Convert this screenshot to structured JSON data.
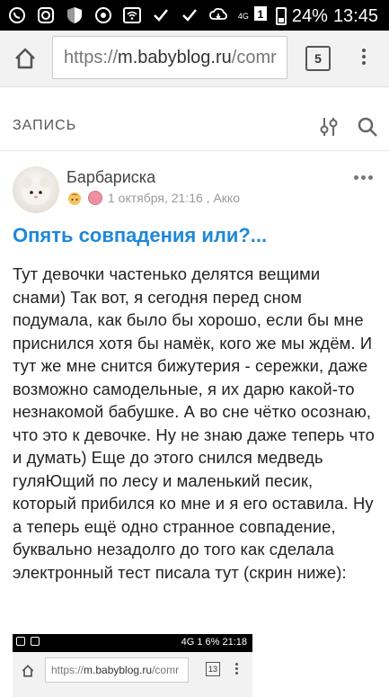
{
  "status": {
    "network": "4G",
    "sim": "1",
    "battery": "24%",
    "time": "13:45"
  },
  "browser": {
    "url_scheme": "https://",
    "url_host": "m.babyblog.ru",
    "url_rest": "/comr",
    "tab_count": "5"
  },
  "section": {
    "title": "ЗАПИСЬ"
  },
  "post": {
    "author": "Барбариска",
    "date": "1 октября, 21:16 , Акко",
    "title": "Опять совпадения или?...",
    "body": "Тут девочки частенько делятся вещими снами) Так вот, я сегодня перед сном подумала, как было бы хорошо, если бы мне приснился хотя бы намёк, кого же мы ждём. И тут же мне снится бижутерия - сережки, даже возможно самодельные, я их дарю какой-то незнакомой бабушке. А во сне чётко осознаю, что это к девочке. Ну не знаю даже теперь что и думать) Еще до этого снился медведь гуляЮщий по лесу и маленький песик, который прибился ко мне и я его оставила. Ну а теперь ещё одно странное совпадение, буквально незадолго до того как сделала электронный тест писала тут (скрин ниже):"
  },
  "embedded_screenshot": {
    "status_right": "4G 1 6% 21:18",
    "url_scheme": "https://",
    "url_host": "m.babyblog.ru",
    "url_rest": "/comr",
    "tab_count": "13"
  },
  "colors": {
    "link_blue": "#1e88d9",
    "status_bg": "#000000",
    "urlbar_bg": "#f2f2f2"
  }
}
